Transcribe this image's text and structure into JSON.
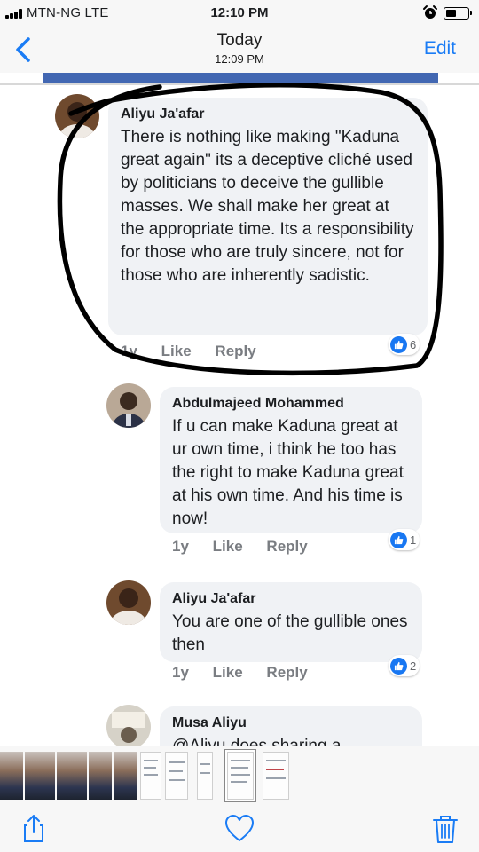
{
  "status_bar": {
    "carrier": "MTN-NG  LTE",
    "time": "12:10 PM"
  },
  "nav": {
    "title": "Today",
    "subtitle": "12:09 PM",
    "edit_label": "Edit",
    "accent_color": "#1a7cf5"
  },
  "comments": [
    {
      "author": "Aliyu Ja'afar",
      "text": "There is nothing like making \"Kaduna great again\" its a deceptive cliché used by politicians to deceive the gullible masses. We shall make her great at the appropriate time. Its a responsibility for those who are truly sincere, not for those who are inherently sadistic.",
      "age": "1y",
      "like_label": "Like",
      "reply_label": "Reply",
      "reactions": "6"
    },
    {
      "author": "Abdulmajeed Mohammed",
      "text": "If u can make Kaduna great at ur own time, i think he too has the right to make Kaduna great at his own time. And his time is now!",
      "age": "1y",
      "like_label": "Like",
      "reply_label": "Reply",
      "reactions": "1"
    },
    {
      "author": "Aliyu Ja'afar",
      "text": "You are one of the gullible ones then",
      "age": "1y",
      "like_label": "Like",
      "reply_label": "Reply",
      "reactions": "2"
    },
    {
      "author": "Musa Aliyu",
      "text": "@Aliyu  does sharing a"
    }
  ],
  "toolbar": {
    "share_icon": "share-icon",
    "favorite_icon": "heart-icon",
    "delete_icon": "trash-icon"
  }
}
